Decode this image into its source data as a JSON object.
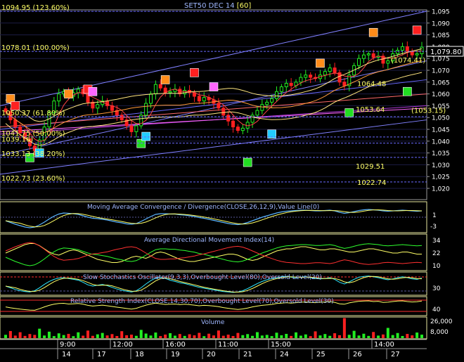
{
  "title": "SET50 DEC 14",
  "interval": "[60]",
  "colors": {
    "background": "#000000",
    "grid": "#3a3a7a",
    "up": "#22ee22",
    "down": "#ff2020",
    "axis_text": "#ffffff",
    "fib_text": "#ffff66",
    "panel_border": "#e8e8a0",
    "title_text": "#a0b8ff"
  },
  "price_axis": {
    "ticks": [
      "1,095",
      "1,090",
      "1,085",
      "1,080",
      "1,075",
      "1,070",
      "1,065",
      "1,060",
      "1,055",
      "1,050",
      "1,045",
      "1,040",
      "1,035",
      "1,030",
      "1,025",
      "1,020"
    ],
    "last_price": "1,079.80"
  },
  "fib_labels": [
    {
      "text": "1094.95 (123.60%)",
      "value": 1094.95
    },
    {
      "text": "1078.01 (100.00%)",
      "value": 1078.01
    },
    {
      "text": "1050.37 (61.80%)",
      "value": 1050.37
    },
    {
      "text": "1041.75 (50.00%)",
      "value": 1041.75
    },
    {
      "text": "1039.16)",
      "value": 1039.16
    },
    {
      "text": "1033.13 (38.20%)",
      "value": 1033.13
    },
    {
      "text": "1022.73 (23.60%)",
      "value": 1022.73
    }
  ],
  "price_annotations": [
    {
      "text": "(1074.41)",
      "value": 1074.41
    },
    {
      "text": "1064.48",
      "value": 1064.48
    },
    {
      "text": "1053.64",
      "value": 1053.64
    },
    {
      "text": "(1053.15)",
      "value": 1053.15
    },
    {
      "text": "1029.51",
      "value": 1029.51
    },
    {
      "text": "1022.74",
      "value": 1022.74
    }
  ],
  "indicators": {
    "macd": {
      "title": "Moving Average Convergence / Divergence(CLOSE,26,12,9),Value Line(0)",
      "ticks": [
        "1",
        "-3"
      ]
    },
    "adx": {
      "title": "Average Directional Movement Index(14)",
      "ticks": [
        "34",
        "22",
        "10"
      ]
    },
    "stoch": {
      "title": "Slow Stochastics Oscillator(9,3,3),Overbought Level(80),Oversold Level(20)",
      "ticks": [
        "30"
      ]
    },
    "rsi": {
      "title": "Relative Strength Index(CLOSE,14,30,70),Overbought Level(70),Oversold Level(30)",
      "ticks": [
        "40"
      ]
    },
    "volume": {
      "title": "Volume",
      "ticks": [
        "26,000",
        "8,000"
      ]
    }
  },
  "time_axis": {
    "times": [
      "9:00",
      "12:00",
      "16:00",
      "11:00",
      "15:00",
      "14:00"
    ],
    "days": [
      "14",
      "17",
      "18",
      "19",
      "20",
      "21",
      "24",
      "25",
      "26",
      "27"
    ]
  },
  "chart_data": {
    "type": "candlestick",
    "symbol": "SET50 DEC 14",
    "interval": "[60]",
    "ylim": [
      1018,
      1096
    ],
    "closes": [
      1052.5,
      1049.0,
      1046.0,
      1043.5,
      1041.0,
      1038.0,
      1036.0,
      1040.5,
      1046.0,
      1052.0,
      1057.0,
      1060.0,
      1061.0,
      1059.0,
      1060.5,
      1062.0,
      1060.0,
      1056.5,
      1054.0,
      1055.5,
      1057.0,
      1055.0,
      1053.0,
      1051.0,
      1049.0,
      1046.5,
      1044.0,
      1046.5,
      1051.0,
      1056.0,
      1060.0,
      1064.0,
      1062.5,
      1060.5,
      1061.0,
      1062.0,
      1060.0,
      1061.5,
      1060.5,
      1059.0,
      1057.0,
      1058.5,
      1057.5,
      1056.0,
      1054.0,
      1051.0,
      1048.5,
      1046.0,
      1044.5,
      1045.5,
      1048.0,
      1051.0,
      1053.0,
      1055.5,
      1056.5,
      1058.0,
      1061.0,
      1063.0,
      1064.5,
      1063.5,
      1065.0,
      1067.0,
      1068.0,
      1067.0,
      1066.5,
      1068.0,
      1069.5,
      1071.0,
      1069.0,
      1065.0,
      1063.5,
      1068.0,
      1072.0,
      1075.0,
      1076.5,
      1077.0,
      1075.5,
      1076.0,
      1073.0,
      1074.0,
      1077.0,
      1078.5,
      1080.0,
      1078.0,
      1076.5,
      1077.0,
      1079.8
    ],
    "volume": [
      4200,
      9000,
      3200,
      7500,
      2800,
      5200,
      4100,
      12000,
      3300,
      8200,
      2600,
      6100,
      3900,
      5400,
      2500,
      7400,
      3100,
      9600,
      2900,
      4800,
      6600,
      3400,
      5100,
      2700,
      8800,
      3600,
      4400,
      2900,
      10500,
      5800,
      3300,
      7100,
      2600,
      4500,
      6300,
      3100,
      5200,
      2800,
      4900,
      3500,
      6700,
      2500,
      5600,
      3400,
      9700,
      3000,
      4400,
      2700,
      6600,
      3800,
      5100,
      2900,
      7600,
      3300,
      4100,
      2600,
      6900,
      3600,
      5400,
      2800,
      7300,
      3100,
      4700,
      2500,
      8600,
      3400,
      5200,
      2900,
      6200,
      3700,
      25500,
      4200,
      9300,
      3300,
      5600,
      2800,
      7800,
      3200,
      4600,
      13000,
      3900,
      6500,
      2700,
      5300,
      3500,
      7100,
      4400
    ],
    "series": [
      {
        "name": "MACD",
        "values": [
          -1.0,
          -1.5,
          -2.0,
          -2.4,
          -2.8,
          -3.0,
          -2.8,
          -2.2,
          -1.4,
          -0.5,
          0.3,
          0.9,
          1.2,
          1.1,
          1.0,
          0.8,
          0.4,
          0.0,
          -0.3,
          -0.4,
          -0.6,
          -0.8,
          -1.1,
          -1.4,
          -1.6,
          -1.9,
          -2.0,
          -1.8,
          -1.2,
          -0.5,
          0.2,
          0.8,
          1.0,
          1.0,
          0.9,
          0.9,
          0.7,
          0.6,
          0.4,
          0.2,
          -0.1,
          -0.3,
          -0.6,
          -0.9,
          -1.2,
          -1.5,
          -1.8,
          -2.0,
          -2.1,
          -1.9,
          -1.5,
          -1.0,
          -0.5,
          0.0,
          0.4,
          0.8,
          1.2,
          1.5,
          1.7,
          1.8,
          1.9,
          2.0,
          2.0,
          1.9,
          1.8,
          1.8,
          1.9,
          2.0,
          1.8,
          1.4,
          1.1,
          1.3,
          1.6,
          1.9,
          2.1,
          2.2,
          2.1,
          2.0,
          1.8,
          1.7,
          1.8,
          1.9,
          2.0,
          1.9,
          1.8,
          1.7,
          1.8
        ]
      },
      {
        "name": "ADX",
        "values": [
          24,
          26,
          28,
          30,
          32,
          33,
          33,
          31,
          28,
          25,
          23,
          22,
          24,
          26,
          27,
          26,
          24,
          22,
          20,
          18,
          17,
          16,
          15,
          15,
          16,
          18,
          20,
          21,
          20,
          19,
          21,
          24,
          25,
          24,
          22,
          20,
          18,
          17,
          16,
          16,
          17,
          18,
          19,
          20,
          21,
          22,
          23,
          23,
          22,
          20,
          18,
          17,
          18,
          20,
          22,
          24,
          26,
          27,
          28,
          28,
          29,
          30,
          30,
          29,
          28,
          27,
          27,
          28,
          28,
          27,
          26,
          25,
          25,
          26,
          27,
          28,
          28,
          27,
          26,
          25,
          24,
          24,
          25,
          25,
          24,
          23,
          23
        ]
      },
      {
        "name": "Slow %K",
        "values": [
          40,
          32,
          24,
          18,
          14,
          12,
          18,
          32,
          48,
          62,
          72,
          78,
          80,
          76,
          72,
          68,
          58,
          46,
          40,
          44,
          48,
          42,
          34,
          26,
          20,
          16,
          12,
          18,
          32,
          50,
          66,
          78,
          82,
          76,
          68,
          62,
          56,
          52,
          46,
          40,
          34,
          30,
          26,
          22,
          18,
          14,
          12,
          10,
          12,
          18,
          28,
          40,
          52,
          62,
          70,
          76,
          80,
          84,
          86,
          82,
          80,
          82,
          84,
          80,
          76,
          74,
          76,
          80,
          72,
          58,
          50,
          60,
          72,
          82,
          86,
          88,
          84,
          80,
          74,
          70,
          74,
          80,
          84,
          80,
          74,
          72,
          78
        ]
      },
      {
        "name": "RSI",
        "values": [
          48,
          44,
          41,
          38,
          36,
          34,
          33,
          40,
          48,
          55,
          60,
          63,
          64,
          61,
          62,
          63,
          60,
          55,
          52,
          54,
          56,
          53,
          50,
          47,
          44,
          41,
          38,
          42,
          49,
          56,
          61,
          65,
          62,
          59,
          60,
          61,
          58,
          60,
          58,
          56,
          53,
          55,
          54,
          52,
          49,
          45,
          42,
          39,
          37,
          39,
          43,
          48,
          52,
          55,
          57,
          59,
          63,
          65,
          67,
          65,
          67,
          69,
          70,
          68,
          67,
          69,
          70,
          72,
          68,
          62,
          60,
          66,
          70,
          73,
          74,
          75,
          72,
          73,
          68,
          69,
          72,
          74,
          75,
          72,
          70,
          71,
          74
        ]
      }
    ]
  }
}
